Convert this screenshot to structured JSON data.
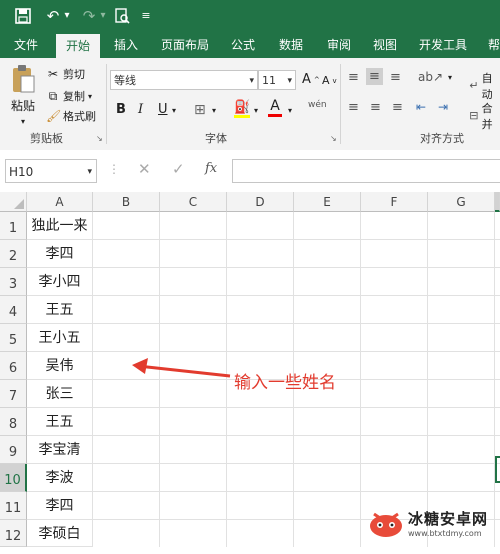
{
  "quick_access": {
    "save": "save-icon",
    "undo": "undo-icon",
    "redo": "redo-icon",
    "preview": "print-preview-icon",
    "customize": "customize-icon"
  },
  "tabs": [
    "文件",
    "开始",
    "插入",
    "页面布局",
    "公式",
    "数据",
    "审阅",
    "视图",
    "开发工具",
    "帮"
  ],
  "active_tab": "开始",
  "clipboard": {
    "paste": "粘贴",
    "cut": "剪切",
    "copy": "复制",
    "format_painter": "格式刷",
    "group": "剪贴板"
  },
  "font": {
    "name": "等线",
    "size": "11",
    "bold": "B",
    "italic": "I",
    "underline": "U",
    "group": "字体",
    "grow": "A",
    "shrink": "A",
    "color": "A",
    "phonetic": "wén"
  },
  "alignment": {
    "group": "对齐方式",
    "wrap": "自动",
    "merge": "合并"
  },
  "formula_bar": {
    "name_box": "H10",
    "fx": "fx",
    "formula": ""
  },
  "columns": [
    "A",
    "B",
    "C",
    "D",
    "E",
    "F",
    "G"
  ],
  "rows": [
    {
      "num": "1",
      "a": "独此一来"
    },
    {
      "num": "2",
      "a": "李四"
    },
    {
      "num": "3",
      "a": "李小四"
    },
    {
      "num": "4",
      "a": "王五"
    },
    {
      "num": "5",
      "a": "王小五"
    },
    {
      "num": "6",
      "a": "吴伟"
    },
    {
      "num": "7",
      "a": "张三"
    },
    {
      "num": "8",
      "a": "王五"
    },
    {
      "num": "9",
      "a": "李宝清"
    },
    {
      "num": "10",
      "a": "李波"
    },
    {
      "num": "11",
      "a": "李四"
    },
    {
      "num": "12",
      "a": "李硕白"
    }
  ],
  "annotation": "输入一些姓名",
  "watermark": {
    "title": "冰糖安卓网",
    "url": "www.btxtdmy.com"
  },
  "colors": {
    "excel_green": "#217346",
    "annotation_red": "#e23b2e"
  }
}
